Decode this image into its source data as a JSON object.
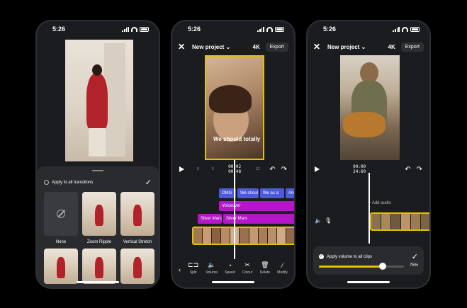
{
  "status": {
    "time": "5:26"
  },
  "phone1": {
    "apply_label": "Apply to all transitions",
    "thumbs": [
      {
        "label": "None"
      },
      {
        "label": "Zoom Ripple"
      },
      {
        "label": "Vertical Stretch"
      }
    ]
  },
  "editor": {
    "project_title": "New project",
    "resolution": "4K",
    "export_label": "Export"
  },
  "phone2": {
    "timecode_current": "00:02",
    "timecode_total": "00:48",
    "tick_0": "0",
    "tick_3": "3",
    "tick_12": "12",
    "tracks": {
      "t1": "OMG",
      "t2": "We shoul",
      "t3": "We as a",
      "t4": "And",
      "voiceover": "Voiceover",
      "silver1": "Silver Mars",
      "silver2": "Silver Mars"
    },
    "tools": [
      {
        "label": "Split",
        "icon": "⊏⊐"
      },
      {
        "label": "Volume",
        "icon": "🔈"
      },
      {
        "label": "Speed",
        "icon": "◔"
      },
      {
        "label": "Colour",
        "icon": "✂"
      },
      {
        "label": "Delete",
        "icon": "🗑"
      },
      {
        "label": "Modify",
        "icon": "⁄"
      }
    ],
    "caption": "We should totally"
  },
  "phone3": {
    "timecode_current": "00:00",
    "timecode_total": "24:60",
    "add_audio": "Add audio",
    "apply_volume": "Apply volume to all clips",
    "volume_pct": "75%",
    "volume_value": 0.75
  },
  "colors": {
    "accent": "#e3c000",
    "track_blue": "#4d5bd6",
    "track_magenta": "#b516c8"
  }
}
